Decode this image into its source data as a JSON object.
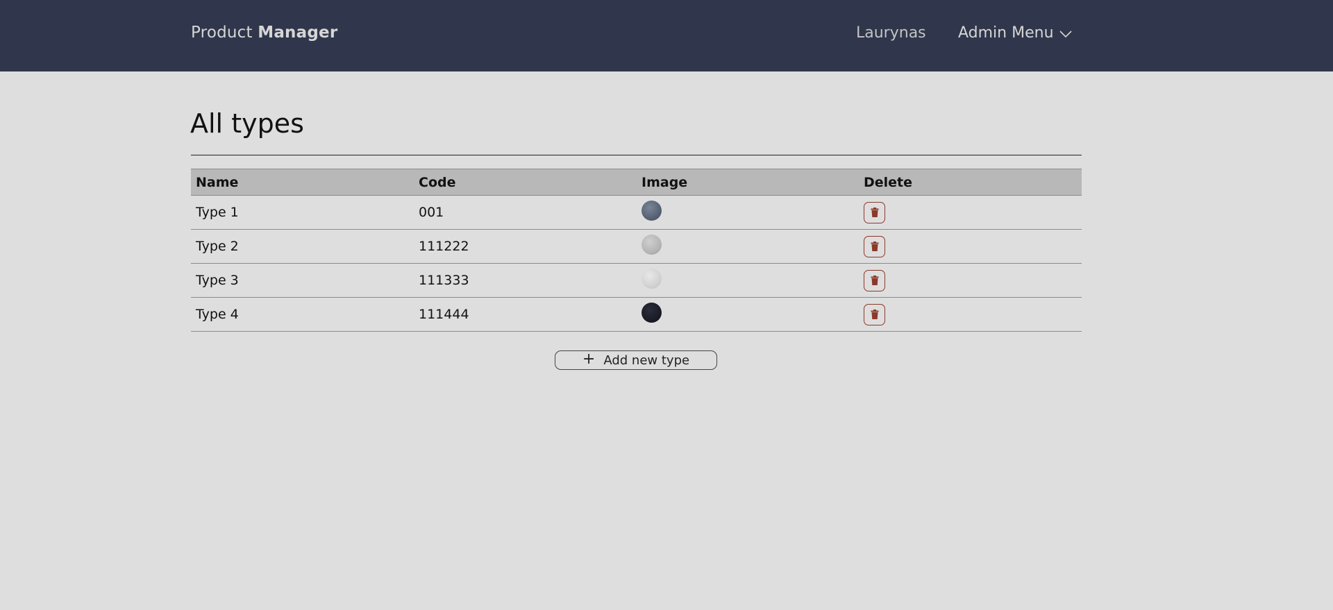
{
  "header": {
    "brand_light": "Product",
    "brand_bold": "Manager",
    "user_name": "Laurynas",
    "admin_menu_label": "Admin Menu"
  },
  "page": {
    "title": "All types"
  },
  "table": {
    "columns": [
      "Name",
      "Code",
      "Image",
      "Delete"
    ],
    "rows": [
      {
        "name": "Type 1",
        "code": "001"
      },
      {
        "name": "Type 2",
        "code": "111222"
      },
      {
        "name": "Type 3",
        "code": "111333"
      },
      {
        "name": "Type 4",
        "code": "111444"
      }
    ]
  },
  "actions": {
    "add_label": "Add new type",
    "add_icon": "+"
  },
  "colors": {
    "header_bg": "#30364b",
    "page_bg": "#dedede",
    "table_header_bg": "#b8b8b8",
    "delete_accent": "#8b3a2a"
  },
  "icons": {
    "admin_menu": "chevron-down-icon",
    "delete": "trash-icon",
    "add": "plus-icon"
  }
}
